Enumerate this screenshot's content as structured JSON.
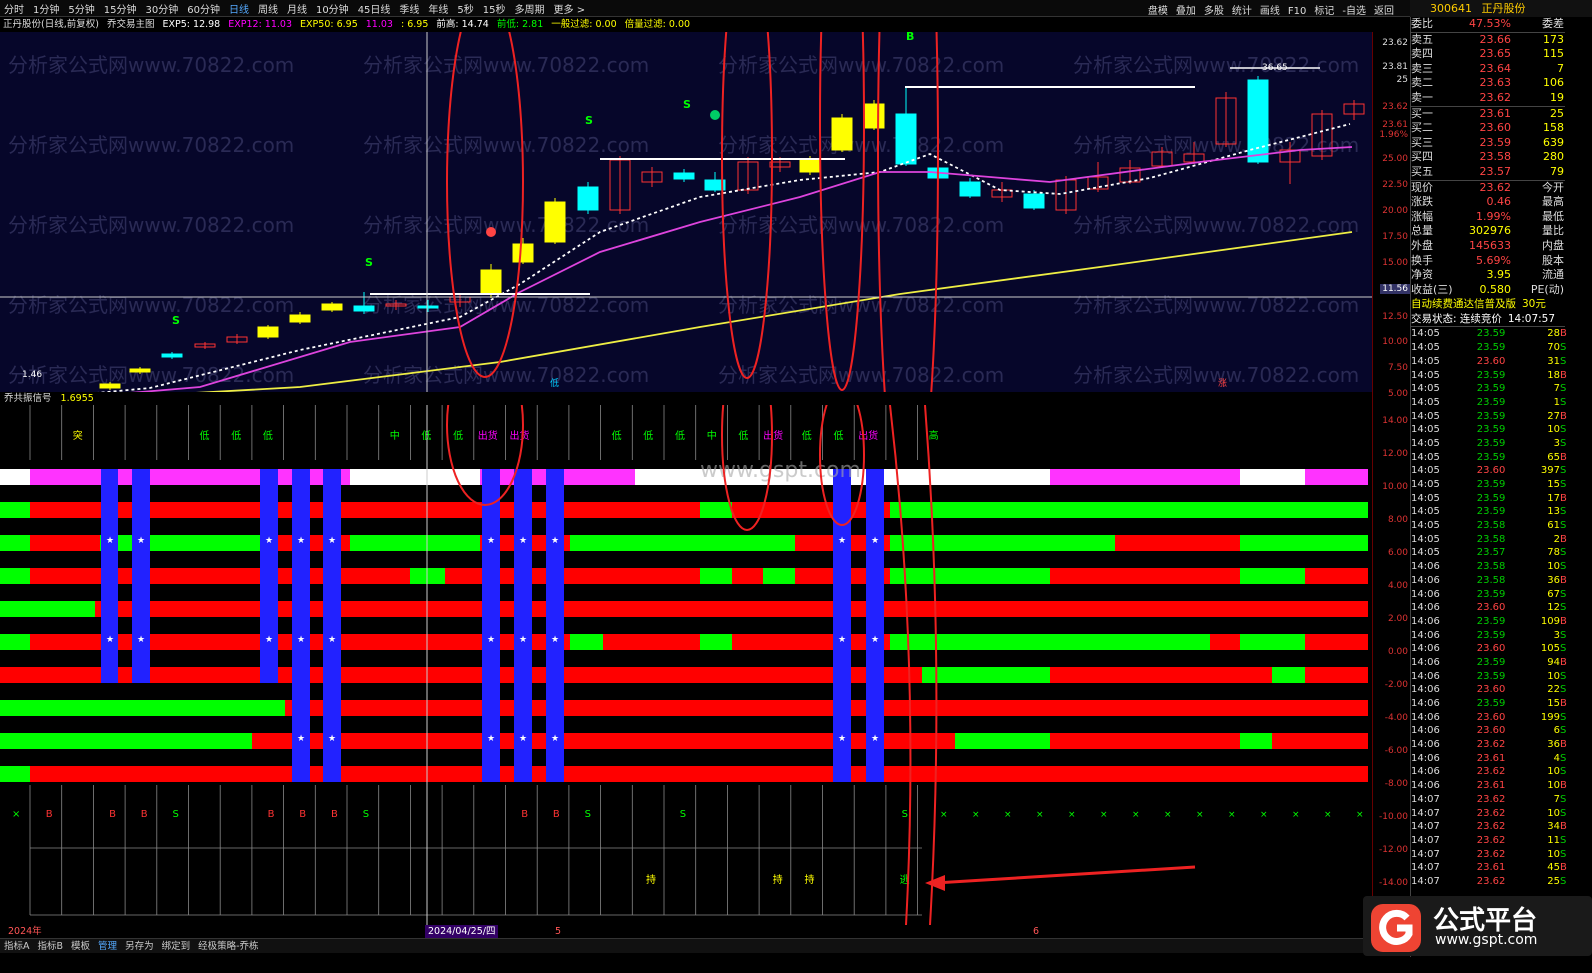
{
  "toolbar": {
    "left": [
      "分时",
      "1分钟",
      "5分钟",
      "15分钟",
      "30分钟",
      "60分钟",
      "日线",
      "周线",
      "月线",
      "10分钟",
      "45日线",
      "季线",
      "年线",
      "5秒",
      "15秒",
      "多周期",
      "更多 >"
    ],
    "active": "日线",
    "right": [
      "盘模",
      "叠加",
      "多股",
      "统计",
      "画线",
      "F10",
      "标记",
      "-自选",
      "返回"
    ]
  },
  "header": {
    "stock_code": "300641",
    "stock_name": "正丹股份"
  },
  "infobar": {
    "title": "正丹股份(日线,前复权)",
    "indicator": "乔交易主图",
    "exp5": "EXP5: 12.98",
    "exp12": "EXP12: 11.03",
    "exp50": "EXP50: 6.95",
    "v1": "11.03",
    "v2": ": 6.95",
    "prev_high": "前高: 14.74",
    "prev_low": "前低: 2.81",
    "filter1": "一般过滤: 0.00",
    "filter2": "倍量过滤: 0.00"
  },
  "main_chart": {
    "labels": {
      "top_high": "36.65",
      "low_mark": "1.46",
      "mark_xu": "低",
      "mark_zhang": "涨",
      "price_line": "11.56"
    },
    "signals": [
      "S",
      "S",
      "S",
      "S",
      "B"
    ]
  },
  "sub_chart": {
    "title": "乔共振信号",
    "value": "1.6955",
    "top_labels": [
      {
        "i": 1,
        "t": "突",
        "c": "#ff0"
      },
      {
        "i": 5,
        "t": "低",
        "c": "#0f0"
      },
      {
        "i": 6,
        "t": "低",
        "c": "#0f0"
      },
      {
        "i": 7,
        "t": "低",
        "c": "#0f0"
      },
      {
        "i": 11,
        "t": "中",
        "c": "#0f0"
      },
      {
        "i": 12,
        "t": "低",
        "c": "#0f0"
      },
      {
        "i": 13,
        "t": "低",
        "c": "#0f0"
      },
      {
        "i": 14,
        "t": "出货",
        "c": "#f0f"
      },
      {
        "i": 15,
        "t": "出货",
        "c": "#f0f"
      },
      {
        "i": 18,
        "t": "低",
        "c": "#0f0"
      },
      {
        "i": 19,
        "t": "低",
        "c": "#0f0"
      },
      {
        "i": 20,
        "t": "低",
        "c": "#0f0"
      },
      {
        "i": 21,
        "t": "中",
        "c": "#0f0"
      },
      {
        "i": 22,
        "t": "低",
        "c": "#0f0"
      },
      {
        "i": 23,
        "t": "出货",
        "c": "#f0f"
      },
      {
        "i": 24,
        "t": "低",
        "c": "#0f0"
      },
      {
        "i": 25,
        "t": "低",
        "c": "#0f0"
      },
      {
        "i": 26,
        "t": "出货",
        "c": "#f0f"
      },
      {
        "i": 28,
        "t": "高",
        "c": "#0f0"
      }
    ],
    "bs_labels": [
      {
        "i": 0,
        "t": "×",
        "c": "#0f0"
      },
      {
        "i": 1,
        "t": "B",
        "c": "#f33"
      },
      {
        "i": 3,
        "t": "B",
        "c": "#f33"
      },
      {
        "i": 4,
        "t": "B",
        "c": "#f33"
      },
      {
        "i": 5,
        "t": "S",
        "c": "#0f0"
      },
      {
        "i": 8,
        "t": "B",
        "c": "#f33"
      },
      {
        "i": 9,
        "t": "B",
        "c": "#f33"
      },
      {
        "i": 10,
        "t": "B",
        "c": "#f33"
      },
      {
        "i": 11,
        "t": "S",
        "c": "#0f0"
      },
      {
        "i": 16,
        "t": "B",
        "c": "#f33"
      },
      {
        "i": 17,
        "t": "B",
        "c": "#f33"
      },
      {
        "i": 18,
        "t": "S",
        "c": "#0f0"
      },
      {
        "i": 21,
        "t": "S",
        "c": "#0f0"
      },
      {
        "i": 28,
        "t": "S",
        "c": "#0f0"
      }
    ],
    "hold_labels": [
      {
        "i": 20,
        "t": "持"
      },
      {
        "i": 24,
        "t": "持"
      },
      {
        "i": 25,
        "t": "持"
      },
      {
        "i": 28,
        "t": "逃"
      }
    ]
  },
  "watermarks": [
    "分析家公式网www.70822.com",
    "www.gspt.com"
  ],
  "axis": {
    "left_ticks": [
      "23.62",
      "23.81",
      "25",
      "23.62",
      "23.61",
      "1.96%",
      "25.00",
      "22.50",
      "20.00",
      "17.50",
      "15.00",
      "12.50",
      "10.00",
      "7.50",
      "5.00"
    ],
    "sub_ticks": [
      "14.00",
      "12.00",
      "10.00",
      "8.00",
      "6.00",
      "4.00",
      "2.00",
      "0.00",
      "-2.00",
      "-4.00",
      "-6.00",
      "-8.00",
      "-10.00",
      "-12.00",
      "-14.00"
    ]
  },
  "bottom": {
    "year": "2024年",
    "date": "2024/04/25/四",
    "m1": "5",
    "m2": "6"
  },
  "tabs": [
    "指标A",
    "指标B",
    "模板",
    "管理",
    "另存为",
    "绑定到",
    "经极策略-乔栋"
  ],
  "panel": {
    "webi": {
      "label": "委比",
      "value": "47.53%",
      "label2": "委差",
      "value2": "173"
    },
    "asks": [
      {
        "l": "卖五",
        "p": "23.66",
        "v": "173"
      },
      {
        "l": "卖四",
        "p": "23.65",
        "v": "115"
      },
      {
        "l": "卖三",
        "p": "23.64",
        "v": "7"
      },
      {
        "l": "卖二",
        "p": "23.63",
        "v": "106"
      },
      {
        "l": "卖一",
        "p": "23.62",
        "v": "19"
      }
    ],
    "bids": [
      {
        "l": "买一",
        "p": "23.61",
        "v": "25"
      },
      {
        "l": "买二",
        "p": "23.60",
        "v": "158"
      },
      {
        "l": "买三",
        "p": "23.59",
        "v": "639"
      },
      {
        "l": "买四",
        "p": "23.58",
        "v": "280"
      },
      {
        "l": "买五",
        "p": "23.57",
        "v": "79"
      }
    ],
    "stats": [
      {
        "a": "现价",
        "b": "23.62",
        "c": "今开"
      },
      {
        "a": "涨跌",
        "b": "0.46",
        "c": "最高"
      },
      {
        "a": "涨幅",
        "b": "1.99%",
        "c": "最低"
      },
      {
        "a": "总量",
        "b": "302976",
        "c": "量比"
      },
      {
        "a": "外盘",
        "b": "145633",
        "c": "内盘"
      },
      {
        "a": "换手",
        "b": "5.69%",
        "c": "股本"
      },
      {
        "a": "净资",
        "b": "3.95",
        "c": "流通"
      },
      {
        "a": "收益(三)",
        "b": "0.580",
        "c": "PE(动)"
      }
    ],
    "notice": "自动续费通达信普及版",
    "notice_price": "30元",
    "trade_status": "交易状态: 连续竞价",
    "trade_time": "14:07:57",
    "ticks": [
      [
        "14:05",
        "23.59",
        "28"
      ],
      [
        "14:05",
        "23.59",
        "70"
      ],
      [
        "14:05",
        "23.60",
        "31"
      ],
      [
        "14:05",
        "23.59",
        "18"
      ],
      [
        "14:05",
        "23.59",
        "7"
      ],
      [
        "14:05",
        "23.59",
        "1"
      ],
      [
        "14:05",
        "23.59",
        "27"
      ],
      [
        "14:05",
        "23.59",
        "10"
      ],
      [
        "14:05",
        "23.59",
        "3"
      ],
      [
        "14:05",
        "23.59",
        "65"
      ],
      [
        "14:05",
        "23.60",
        "397"
      ],
      [
        "14:05",
        "23.59",
        "15"
      ],
      [
        "14:05",
        "23.59",
        "17"
      ],
      [
        "14:05",
        "23.59",
        "13"
      ],
      [
        "14:05",
        "23.58",
        "61"
      ],
      [
        "14:05",
        "23.58",
        "2"
      ],
      [
        "14:05",
        "23.57",
        "78"
      ],
      [
        "14:06",
        "23.58",
        "10"
      ],
      [
        "14:06",
        "23.58",
        "36"
      ],
      [
        "14:06",
        "23.59",
        "67"
      ],
      [
        "14:06",
        "23.60",
        "12"
      ],
      [
        "14:06",
        "23.59",
        "109"
      ],
      [
        "14:06",
        "23.59",
        "3"
      ],
      [
        "14:06",
        "23.60",
        "105"
      ],
      [
        "14:06",
        "23.59",
        "94"
      ],
      [
        "14:06",
        "23.59",
        "10"
      ],
      [
        "14:06",
        "23.60",
        "22"
      ],
      [
        "14:06",
        "23.59",
        "15"
      ],
      [
        "14:06",
        "23.60",
        "199"
      ],
      [
        "14:06",
        "23.60",
        "6"
      ],
      [
        "14:06",
        "23.62",
        "36"
      ],
      [
        "14:06",
        "23.61",
        "4"
      ],
      [
        "14:06",
        "23.62",
        "10"
      ],
      [
        "14:06",
        "23.61",
        "10"
      ],
      [
        "14:07",
        "23.62",
        "7"
      ],
      [
        "14:07",
        "23.62",
        "10"
      ],
      [
        "14:07",
        "23.62",
        "34"
      ],
      [
        "14:07",
        "23.62",
        "11"
      ],
      [
        "14:07",
        "23.62",
        "10"
      ],
      [
        "14:07",
        "23.61",
        "45"
      ],
      [
        "14:07",
        "23.62",
        "25"
      ]
    ]
  },
  "logo": {
    "big": "公式平台",
    "small": "www.gspt.com"
  }
}
